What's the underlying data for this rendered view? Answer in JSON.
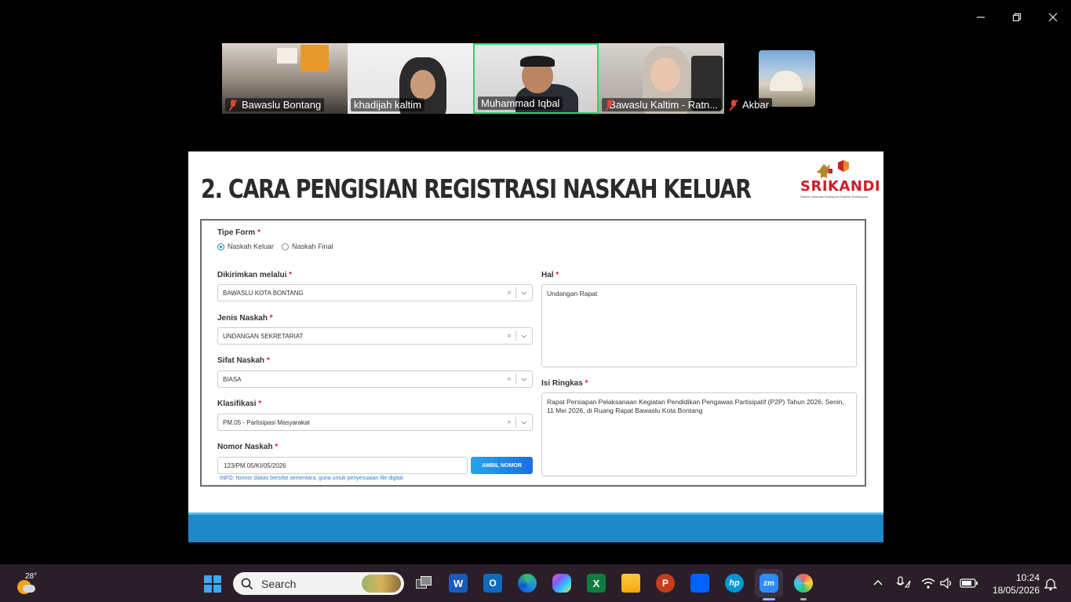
{
  "window_controls": {
    "minimize": "—",
    "restore": "❐",
    "close": "✕"
  },
  "participants": [
    {
      "name": "Bawaslu Bontang",
      "muted": true
    },
    {
      "name": "khadijah kaltim",
      "muted": false
    },
    {
      "name": "Muhammad Iqbal",
      "muted": false,
      "active_speaker": true
    },
    {
      "name": "Bawaslu Kaltim - Ratn...",
      "muted": true
    },
    {
      "name": "Akbar",
      "muted": true
    }
  ],
  "slide": {
    "title": "2. CARA PENGISIAN REGISTRASI NASKAH KELUAR",
    "logo_text": "SRIKANDI",
    "logo_tagline": "Sistem Informasi Kearsipan Dinamis Terintegrasi"
  },
  "form": {
    "tipe_form": {
      "label": "Tipe Form",
      "options": [
        "Naskah Keluar",
        "Naskah Final"
      ],
      "selected": "Naskah Keluar"
    },
    "dikirimkan_melalui": {
      "label": "Dikirimkan melalui",
      "value": "BAWASLU KOTA BONTANG"
    },
    "jenis_naskah": {
      "label": "Jenis Naskah",
      "value": "UNDANGAN SEKRETARIAT"
    },
    "sifat_naskah": {
      "label": "Sifat Naskah",
      "value": "BIASA"
    },
    "klasifikasi": {
      "label": "Klasifikasi",
      "value": "PM.05 - Partisipasi Masyarakat"
    },
    "nomor_naskah": {
      "label": "Nomor Naskah",
      "value": "123/PM.05/KI/05/2026",
      "button": "AMBIL NOMOR",
      "info": "INFO: Nomor diatas bersifat sementara, guna untuk penyesuaian file digital."
    },
    "hal": {
      "label": "Hal",
      "value": "Undangan Rapat"
    },
    "isi_ringkas": {
      "label": "Isi Ringkas",
      "value": "Rapat Persiapan Pelaksanaan Kegiatan Pendidikan Pengawas Partisipatif (P2P) Tahun 2026, Senin, 11 Mei 2026, di Ruang Rapat Bawaslu Kota Bontang"
    },
    "required_mark": "*",
    "clear_glyph": "×"
  },
  "taskbar": {
    "weather_temp": "28°",
    "search_placeholder": "Search",
    "apps": [
      "task-view",
      "word",
      "outlook",
      "edge",
      "copilot",
      "excel",
      "file-explorer",
      "powerpoint",
      "dropbox",
      "hp",
      "zoom",
      "paint"
    ],
    "active_app": "zoom",
    "time": "10:24",
    "date": "18/05/2026"
  },
  "colors": {
    "active_speaker_border": "#23d96c",
    "muted_icon": "#e0443a",
    "brand_red": "#c8202b",
    "button_blue": "#1d84c6",
    "slide_footer": "#1e88c8"
  }
}
